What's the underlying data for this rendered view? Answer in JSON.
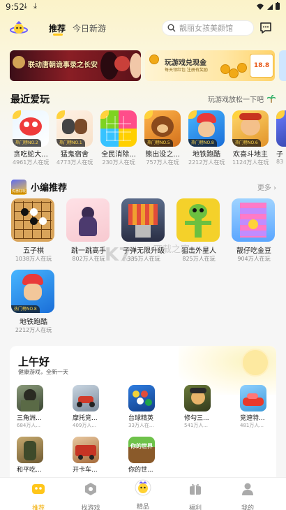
{
  "status": {
    "time": "9:52"
  },
  "nav": {
    "tabs": [
      {
        "label": "推荐"
      },
      {
        "label": "今日新游"
      },
      {
        "label": ""
      }
    ],
    "search_placeholder": "靓丽女孩美颜馆"
  },
  "banners": [
    {
      "text": "联动唐朝诡事录之长安"
    },
    {
      "title": "玩游戏兑现金",
      "subtitle": "每天领红包 注册有奖励",
      "amount": "18.8"
    }
  ],
  "recent": {
    "title": "最近爱玩",
    "more": "玩游戏放松一下吧",
    "games": [
      {
        "name": "贪吃蛇大...",
        "count": "4961万人在玩",
        "badge": "热门榜NO.2"
      },
      {
        "name": "猛鬼宿舍",
        "count": "4773万人在玩",
        "badge": "热门榜NO.1"
      },
      {
        "name": "全民消除...",
        "count": "230万人在玩",
        "badge": ""
      },
      {
        "name": "熊出没之...",
        "count": "757万人在玩",
        "badge": "热门榜NO.5"
      },
      {
        "name": "地铁跑酷",
        "count": "2212万人在玩",
        "badge": "热门榜NO.8"
      },
      {
        "name": "欢喜斗地主",
        "count": "1124万人在玩",
        "badge": "热门榜NO.6"
      },
      {
        "name": "子",
        "count": "83",
        "badge": ""
      }
    ]
  },
  "editor": {
    "avatar_label": "优惠好玩",
    "title": "小编推荐",
    "more": "更多",
    "games": [
      {
        "name": "五子棋",
        "count": "1038万人在玩",
        "badge": ""
      },
      {
        "name": "跳一跳高手",
        "count": "802万人在玩",
        "badge": ""
      },
      {
        "name": "子弹无限升级",
        "count": "335万人在玩",
        "badge": ""
      },
      {
        "name": "狙击外星人",
        "count": "825万人在玩",
        "badge": ""
      },
      {
        "name": "靓仔吃金豆",
        "count": "904万人在玩",
        "badge": ""
      },
      {
        "name": "地铁跑酷",
        "count": "2212万人在玩",
        "badge": "热门榜NO.8"
      }
    ]
  },
  "morning": {
    "title": "上午好",
    "subtitle": "健康游戏，全新一天",
    "games": [
      {
        "name": "三角洲...",
        "count": "684万人..."
      },
      {
        "name": "摩托竞...",
        "count": "409万人..."
      },
      {
        "name": "台球精英",
        "count": "33万人在..."
      },
      {
        "name": "修勾三...",
        "count": "541万人..."
      },
      {
        "name": "竞速特...",
        "count": "481万人..."
      },
      {
        "name": "和平吃...",
        "count": ""
      },
      {
        "name": "开卡车...",
        "count": ""
      },
      {
        "name": "你的世...",
        "count": ""
      }
    ],
    "icon_text": "你的世界"
  },
  "watermark": {
    "main": "K7",
    "site": "下载之家",
    "url": ".com"
  },
  "bottom_nav": [
    {
      "label": "推荐"
    },
    {
      "label": "找游戏"
    },
    {
      "label": "精品"
    },
    {
      "label": "福利"
    },
    {
      "label": "我的"
    }
  ],
  "colors": {
    "accent": "#ffc61a",
    "active_text": "#f2ac00"
  }
}
